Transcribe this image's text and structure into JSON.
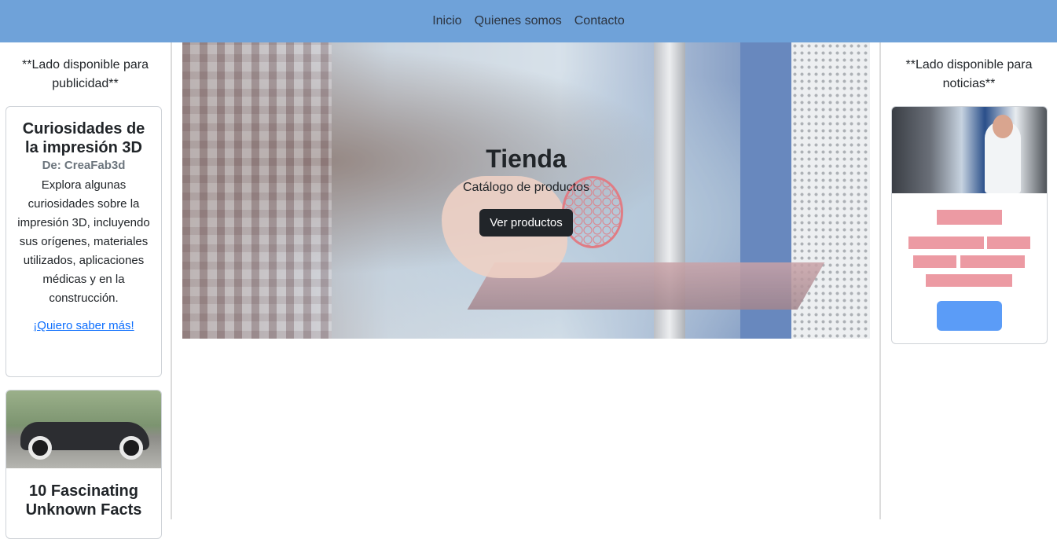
{
  "nav": {
    "items": [
      "Inicio",
      "Quienes somos",
      "Contacto"
    ]
  },
  "left": {
    "note": "**Lado disponible para publicidad**",
    "article": {
      "title": "Curiosidades de la impresión 3D",
      "subtitle": "De: CreaFab3d",
      "text": "Explora algunas curiosidades sobre la impresión 3D, incluyendo sus orígenes, materiales utilizados, aplicaciones médicas y en la construcción.",
      "link": "¡Quiero saber más!"
    },
    "car_card": {
      "title": "10 Fascinating Unknown Facts"
    }
  },
  "hero": {
    "title": "Tienda",
    "subtitle": "Catálogo de productos",
    "button": "Ver productos"
  },
  "right": {
    "note": "**Lado disponible para noticias**"
  },
  "colors": {
    "navbar": "#6fa2d9",
    "placeholder": "#ec9aa3",
    "placeholder_button": "#5b9cf7",
    "link": "#0d6efd",
    "button": "#212529"
  }
}
